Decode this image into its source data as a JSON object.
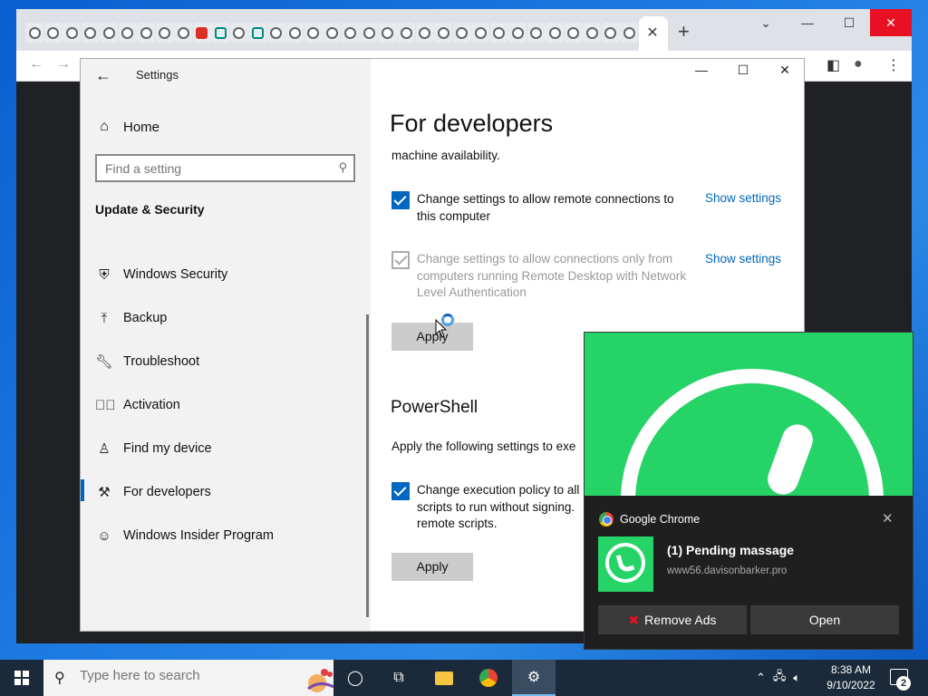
{
  "settings": {
    "title": "Settings",
    "home_label": "Home",
    "search_placeholder": "Find a setting",
    "section_title": "Update & Security",
    "nav_items": [
      {
        "label": "Windows Security",
        "icon": "shield-icon"
      },
      {
        "label": "Backup",
        "icon": "backup-arrow-icon"
      },
      {
        "label": "Troubleshoot",
        "icon": "wrench-icon"
      },
      {
        "label": "Activation",
        "icon": "check-circle-icon"
      },
      {
        "label": "Find my device",
        "icon": "person-pin-icon"
      },
      {
        "label": "For developers",
        "icon": "developer-tools-icon"
      },
      {
        "label": "Windows Insider Program",
        "icon": "insider-cat-icon"
      }
    ],
    "selected_nav": "For developers",
    "page_title": "For developers",
    "intro_text": "machine availability.",
    "remote_option": {
      "label": "Change settings to allow remote connections to this computer",
      "checked": true,
      "link": "Show settings"
    },
    "nla_option": {
      "label": "Change settings to allow connections only from computers running Remote Desktop with Network Level Authentication",
      "checked": true,
      "disabled": true,
      "link": "Show settings"
    },
    "apply_label": "Apply",
    "powershell_title": "PowerShell",
    "powershell_text": "Apply the following settings to exe",
    "exec_option": {
      "label": "Change execution policy to all scripts to run without signing. remote scripts.",
      "line1": "Change execution policy to all",
      "line2": "scripts to run without signing.",
      "line3": "remote scripts.",
      "checked": true
    },
    "apply2_label": "Apply"
  },
  "notification": {
    "app_name": "Google Chrome",
    "title": "(1) Pending massage",
    "source": "www56.davisonbarker.pro",
    "buttons": [
      "Remove Ads",
      "Open"
    ]
  },
  "taskbar": {
    "search_placeholder": "Type here to search",
    "time": "8:38 AM",
    "date": "9/10/2022",
    "notification_count": "2"
  },
  "colors": {
    "accent": "#0067c0",
    "whatsapp_green": "#25d366",
    "close_red": "#e81123"
  }
}
